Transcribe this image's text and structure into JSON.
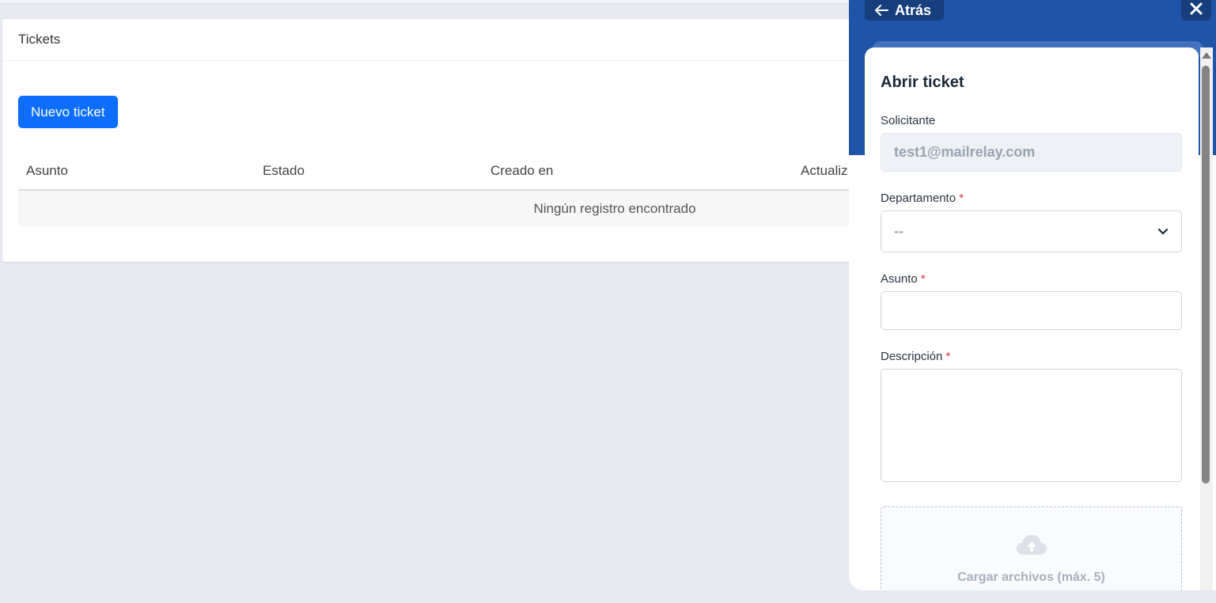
{
  "page": {
    "card_title": "Tickets",
    "new_ticket_label": "Nuevo ticket",
    "table": {
      "columns": [
        "Asunto",
        "Estado",
        "Creado en",
        "Actualiz"
      ],
      "empty_message": "Ningún registro encontrado"
    }
  },
  "panel": {
    "back_label": "Atrás",
    "close_icon": "close-icon",
    "form": {
      "title": "Abrir ticket",
      "requester_label": "Solicitante",
      "requester_value": "test1@mailrelay.com",
      "department_label": "Departamento",
      "department_value": "--",
      "subject_label": "Asunto",
      "description_label": "Descripción",
      "required_mark": "*",
      "upload_label": "Cargar archivos (máx. 5)"
    }
  },
  "colors": {
    "primary": "#0d6efd",
    "panel_header": "#1f55a8",
    "required": "#dc3545",
    "background": "#e7e9f1"
  }
}
